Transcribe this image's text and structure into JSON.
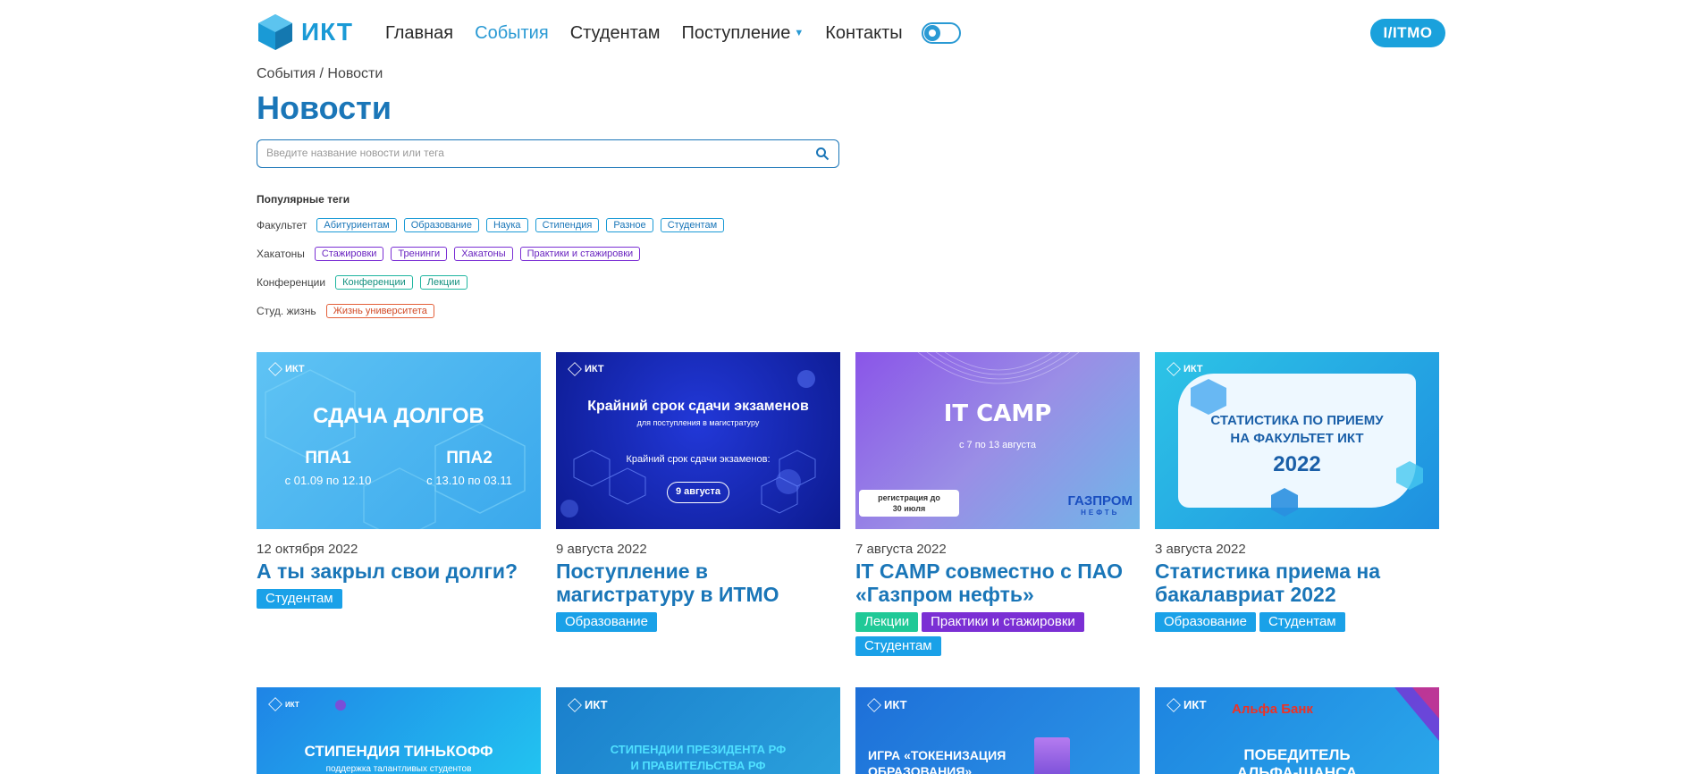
{
  "header": {
    "logo_text": "ИКТ",
    "nav": [
      {
        "label": "Главная"
      },
      {
        "label": "События"
      },
      {
        "label": "Студентам"
      },
      {
        "label": "Поступление"
      },
      {
        "label": "Контакты"
      }
    ],
    "active_nav": "События",
    "itmo_logo": "IʏITMO",
    "itmo_text": "I/ITMO"
  },
  "breadcrumb": "События / Новости",
  "page_title": "Новости",
  "search": {
    "placeholder": "Введите название новости или тега",
    "value": ""
  },
  "tags": {
    "title": "Популярные теги",
    "rows": [
      {
        "category": "Факультет",
        "color": "blue",
        "tags": [
          "Абитуриентам",
          "Образование",
          "Наука",
          "Стипендия",
          "Разное",
          "Студентам"
        ]
      },
      {
        "category": "Хакатоны",
        "color": "purple",
        "tags": [
          "Стажировки",
          "Тренинги",
          "Хакатоны",
          "Практики и стажировки"
        ]
      },
      {
        "category": "Конференции",
        "color": "teal",
        "tags": [
          "Конференции",
          "Лекции"
        ]
      },
      {
        "category": "Студ. жизнь",
        "color": "red",
        "tags": [
          "Жизнь университета"
        ]
      }
    ]
  },
  "cards": [
    {
      "date": "12 октября 2022",
      "title": "А ты закрыл свои долги?",
      "tags": [
        {
          "label": "Студентам",
          "color": "blue"
        }
      ],
      "image": {
        "logo": "ИКТ",
        "heading": "СДАЧА ДОЛГОВ",
        "left_title": "ППА1",
        "left_sub": "с 01.09 по 12.10",
        "right_title": "ППА2",
        "right_sub": "с 13.10 по 03.11"
      }
    },
    {
      "date": "9 августа 2022",
      "title": "Поступление в магистратуру в ИТМО",
      "tags": [
        {
          "label": "Образование",
          "color": "blue"
        }
      ],
      "image": {
        "logo": "ИКТ",
        "heading": "Крайний срок сдачи экзаменов",
        "sub": "для поступления в магистратуру",
        "line": "Крайний срок сдачи экзаменов:",
        "pill": "9 августа"
      }
    },
    {
      "date": "7 августа 2022",
      "title": "IT CAMP совместно с ПАО «Газпром нефть»",
      "tags": [
        {
          "label": "Лекции",
          "color": "green"
        },
        {
          "label": "Практики и стажировки",
          "color": "purple"
        },
        {
          "label": "Студентам",
          "color": "blue"
        }
      ],
      "image": {
        "heading": "IT CAMP",
        "sub": "с 7 по 13 августа",
        "badge_line1": "регистрация до",
        "badge_line2": "30 июля",
        "brand": "ГАЗПРОМ",
        "brand_sub": "НЕФТЬ"
      }
    },
    {
      "date": "3 августа 2022",
      "title": "Статистика приема на бакалавриат 2022",
      "tags": [
        {
          "label": "Образование",
          "color": "blue"
        },
        {
          "label": "Студентам",
          "color": "blue"
        }
      ],
      "image": {
        "logo": "ИКТ",
        "line1": "СТАТИСТИКА ПО ПРИЕМУ",
        "line2": "НА ФАКУЛЬТЕТ ИКТ",
        "year": "2022"
      }
    }
  ],
  "cards_row2": [
    {
      "image": {
        "logo": "ИКТ",
        "heading": "СТИПЕНДИЯ ТИНЬКОФФ",
        "sub": "поддержка талантливых студентов"
      }
    },
    {
      "image": {
        "logo": "ИКТ",
        "line1": "СТИПЕНДИИ ПРЕЗИДЕНТА РФ",
        "line2": "И ПРАВИТЕЛЬСТВА РФ"
      }
    },
    {
      "image": {
        "logo": "ИКТ",
        "line1": "ИГРА «ТОКЕНИЗАЦИЯ",
        "line2": "ОБРАЗОВАНИЯ»"
      }
    },
    {
      "image": {
        "logo": "ИКТ",
        "brand": "Альфа Банк",
        "line1": "ПОБЕДИТЕЛЬ",
        "line2": "АЛЬФА-ШАНСА"
      }
    }
  ]
}
